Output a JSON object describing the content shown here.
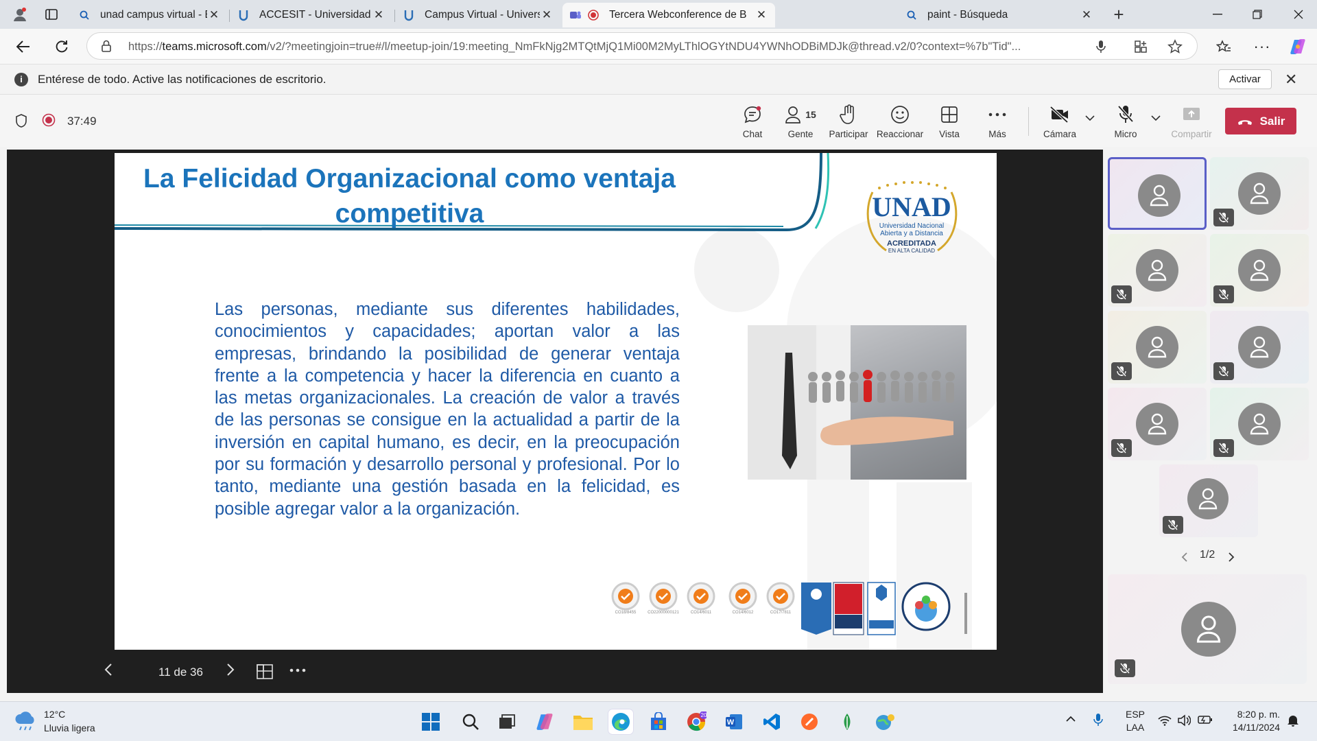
{
  "browser": {
    "tabs": [
      {
        "title": "unad campus virtual - Búsqueda",
        "favicon": "search-icon"
      },
      {
        "title": "ACCESIT - Universidad Nacional A",
        "favicon": "unad-icon"
      },
      {
        "title": "Campus Virtual - Universidad Nac",
        "favicon": "unad-icon"
      },
      {
        "title": "Tercera Webconference de B",
        "favicon": "recording-icon"
      },
      {
        "title": "paint - Búsqueda",
        "favicon": "search-icon"
      }
    ],
    "url_prefix": "https://",
    "url_host": "teams.microsoft.com",
    "url_rest": "/v2/?meetingjoin=true#/l/meetup-join/19:meeting_NmFkNjg2MTQtMjQ1Mi00M2MyLThlOGYtNDU4YWNhODBiMDJk@thread.v2/0?context=%7b\"Tid\"..."
  },
  "notification": {
    "message": "Entérese de todo. Active las notificaciones de escritorio.",
    "action": "Activar"
  },
  "meeting": {
    "timer": "37:49",
    "toolbar": {
      "chat": "Chat",
      "people": "Gente",
      "people_count": "15",
      "raise": "Participar",
      "react": "Reaccionar",
      "view": "Vista",
      "more": "Más",
      "camera": "Cámara",
      "mic": "Micro",
      "share": "Compartir",
      "leave": "Salir"
    }
  },
  "slide": {
    "title_line1": "La Felicidad Organizacional como ventaja",
    "title_line2": "competitiva",
    "body": "Las personas, mediante sus diferentes habilidades, conocimientos y capacidades; aportan valor a las empresas, brindando la posibilidad de generar ventaja frente a la competencia y hacer la diferencia en cuanto a las metas organizacionales. La creación de valor a través de las personas se consigue en la actualidad a partir de la inversión en capital humano, es decir, en la preocupación por su formación y desarrollo personal y profesional. Por lo tanto, mediante una gestión basada en la felicidad, es posible agregar valor a la organización.",
    "logo_text": "UNAD",
    "logo_sub1": "Universidad Nacional",
    "logo_sub2": "Abierta y a Distancia",
    "logo_acc1": "ACREDITADA",
    "logo_acc2": "EN ALTA CALIDAD",
    "certs": [
      "CO18/8455",
      "CO22000000121",
      "CO14/6011",
      "CO14/6012",
      "CO17/7811"
    ],
    "page": "11 de 36"
  },
  "participants": {
    "pager": "1/2"
  },
  "taskbar": {
    "weather_temp": "12°C",
    "weather_desc": "Lluvia ligera",
    "lang1": "ESP",
    "lang2": "LAA",
    "time": "8:20 p. m.",
    "date": "14/11/2024",
    "badge": "20"
  },
  "colors": {
    "accent": "#5b5fc7",
    "leave": "#c4314b",
    "slide_title": "#1b74bb",
    "slide_body": "#1f5aa6"
  }
}
